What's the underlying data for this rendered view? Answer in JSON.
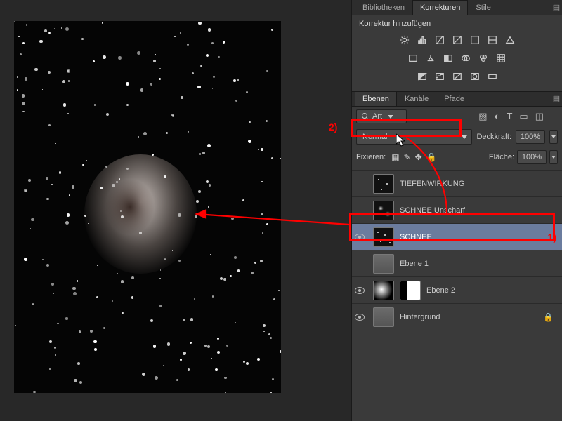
{
  "topTabs": {
    "t0": "Bibliotheken",
    "t1": "Korrekturen",
    "t2": "Stile"
  },
  "adjust": {
    "title": "Korrektur hinzufügen",
    "row1": [
      "brightness",
      "levels",
      "curves",
      "exposure",
      "none",
      "none",
      "triangle"
    ],
    "row2": [
      "square",
      "balance",
      "split",
      "dots",
      "clover",
      "grid"
    ],
    "row3": [
      "sq1",
      "sq2",
      "sq3",
      "sq4",
      "sq5"
    ]
  },
  "layerTabs": {
    "t0": "Ebenen",
    "t1": "Kanäle",
    "t2": "Pfade"
  },
  "filter": {
    "kind": "Art"
  },
  "blend": {
    "mode": "Normal",
    "opacityLabel": "Deckkraft:",
    "opacity": "100%"
  },
  "lock": {
    "label": "Fixieren:",
    "fillLabel": "Fläche:",
    "fill": "100%"
  },
  "annotations": {
    "a1": "1)",
    "a2": "2)"
  },
  "layers": {
    "l0": "TIEFENWIRKUNG",
    "l1": "SCHNEE Unscharf",
    "l2": "SCHNEE",
    "l3": "Ebene 1",
    "l4": "Ebene 2",
    "l5": "Hintergrund"
  }
}
